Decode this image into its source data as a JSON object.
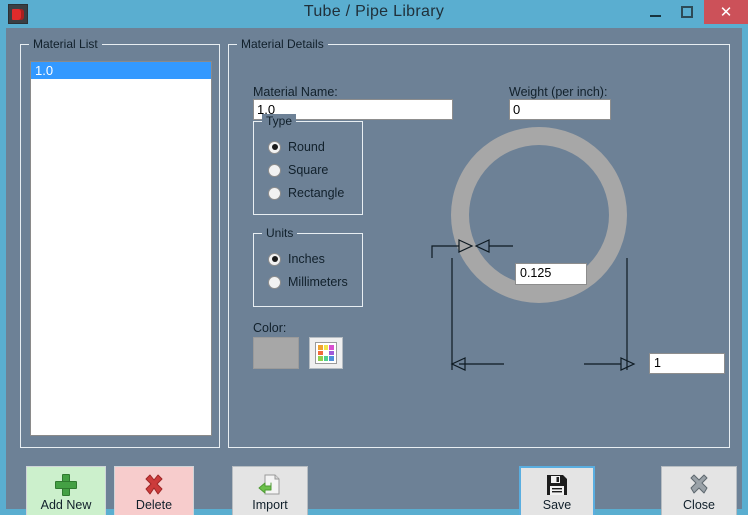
{
  "window": {
    "title": "Tube / Pipe  Library",
    "icon": "app-icon",
    "minimize_label": "–",
    "maximize_label": "□",
    "close_label": "✕",
    "colors": {
      "titlebar": "#5aaed0",
      "client": "#6d8196",
      "close_button": "#cc5159",
      "selection": "#3399ff",
      "focus_border": "#5aaee0"
    }
  },
  "material_list": {
    "group_title": "Material List",
    "items": [
      {
        "label": "1.0",
        "selected": true
      }
    ]
  },
  "material_details": {
    "group_title": "Material Details",
    "material_name": {
      "label": "Material Name:",
      "value": "1.0"
    },
    "weight": {
      "label": "Weight (per inch):",
      "value": "0"
    },
    "type": {
      "group_title": "Type",
      "options": [
        {
          "label": "Round",
          "checked": true
        },
        {
          "label": "Square",
          "checked": false
        },
        {
          "label": "Rectangle",
          "checked": false
        }
      ]
    },
    "units": {
      "group_title": "Units",
      "options": [
        {
          "label": "Inches",
          "checked": true
        },
        {
          "label": "Millimeters",
          "checked": false
        }
      ]
    },
    "color": {
      "label": "Color:",
      "swatch_value": "#a7a7a7",
      "picker_icon": "color-palette-icon",
      "palette_swatches": [
        "#f0a330",
        "#f2e34a",
        "#d94fd0",
        "#f06a3a",
        "#ffffff",
        "#a05ad9",
        "#8fd14f",
        "#4fd18f",
        "#4f8fd9"
      ]
    },
    "diagram": {
      "shape": "round-tube-cross-section",
      "ring_color": "#a7a7a7",
      "thickness": {
        "value": "0.125",
        "dimension": "wall-thickness"
      },
      "diameter": {
        "value": "1",
        "dimension": "outside-diameter"
      }
    }
  },
  "buttons": {
    "add_new": {
      "label": "Add New",
      "icon": "plus-icon"
    },
    "delete": {
      "label": "Delete",
      "icon": "x-mark-icon"
    },
    "import": {
      "label": "Import",
      "icon": "import-document-icon"
    },
    "save": {
      "label": "Save",
      "icon": "floppy-disk-icon"
    },
    "close": {
      "label": "Close",
      "icon": "x-mark-icon"
    }
  }
}
